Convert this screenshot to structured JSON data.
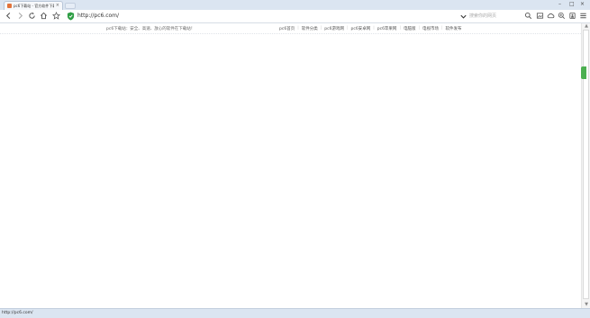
{
  "browser": {
    "tab": {
      "title": "pc6下载站 - 官方软件下载",
      "close": "×"
    },
    "window_controls": {
      "minimize": "–",
      "maximize": "□",
      "close": "×"
    },
    "address": {
      "url": "http://pc6.com/"
    },
    "search": {
      "placeholder": "搜索你的网页"
    },
    "status": {
      "text": "http://pc6.com/"
    }
  },
  "site": {
    "slogan": "pc6下载站：安全、高速、放心的软件在下载站！",
    "nav": [
      {
        "label": "pc6首页"
      },
      {
        "label": "软件分类"
      },
      {
        "label": "pc6游戏网"
      },
      {
        "label": "pc6安卓网"
      },
      {
        "label": "pc6苹果网"
      },
      {
        "label": "电脑版"
      },
      {
        "label": "电视市场"
      },
      {
        "label": "软件发布"
      }
    ]
  },
  "scrollbar": {
    "up": "▲",
    "down": "▼"
  },
  "colors": {
    "chrome": "#dbe5f1",
    "accent_green": "#4caf50",
    "shield_green": "#2e9e44"
  }
}
